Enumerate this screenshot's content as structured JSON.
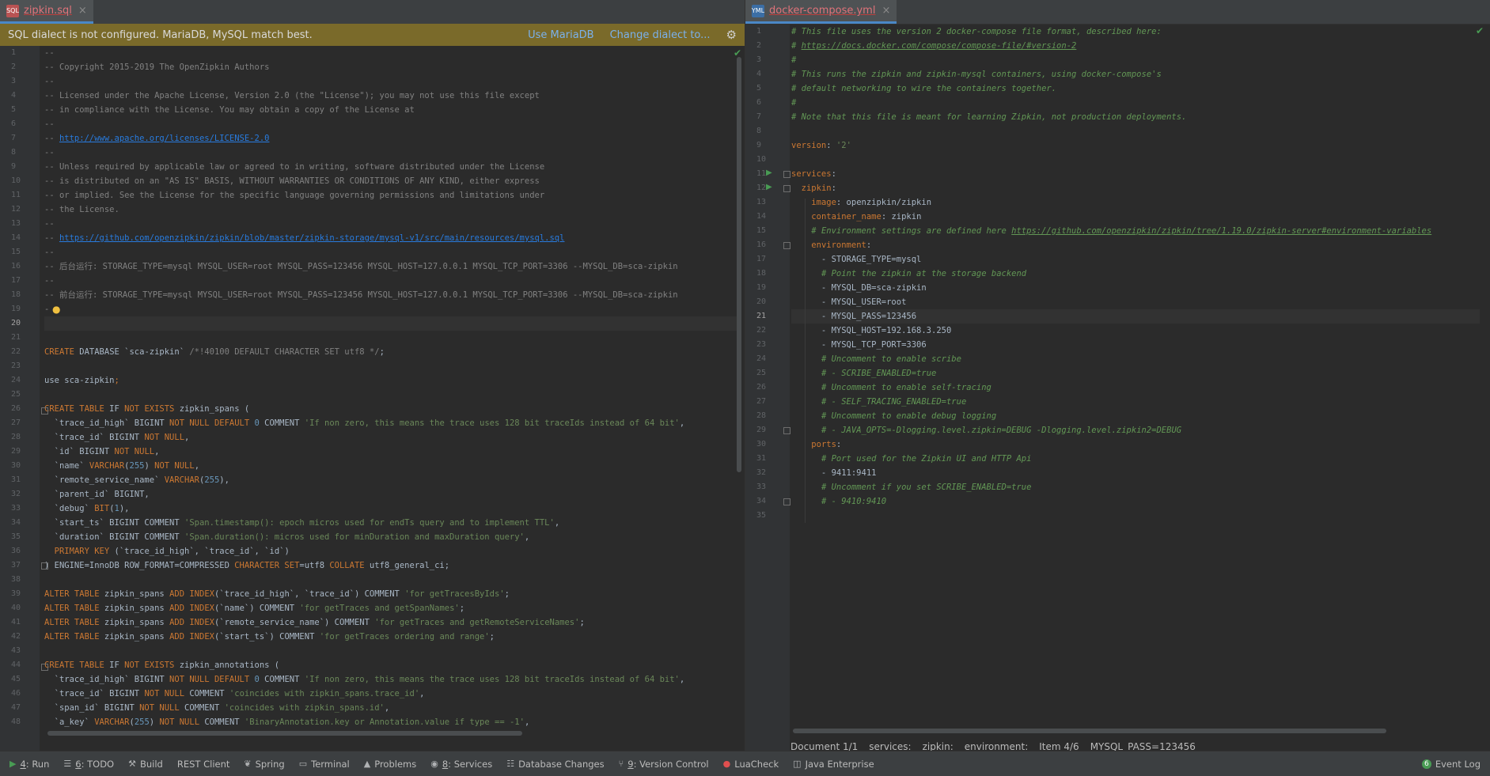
{
  "left": {
    "tab": {
      "title": "zipkin.sql",
      "icon": "sql-file-icon"
    },
    "banner": {
      "text": "SQL dialect is not configured. MariaDB, MySQL match best.",
      "link1": "Use MariaDB",
      "link2": "Change dialect to..."
    },
    "lines": [
      [
        [
          "cm",
          "--"
        ]
      ],
      [
        [
          "cm",
          "-- Copyright 2015-2019 The OpenZipkin Authors"
        ]
      ],
      [
        [
          "cm",
          "--"
        ]
      ],
      [
        [
          "cm",
          "-- Licensed under the Apache License, Version 2.0 (the \"License\"); you may not use this file except"
        ]
      ],
      [
        [
          "cm",
          "-- in compliance with the License. You may obtain a copy of the License at"
        ]
      ],
      [
        [
          "cm",
          "--"
        ]
      ],
      [
        [
          "cm",
          "-- "
        ],
        [
          "url",
          "http://www.apache.org/licenses/LICENSE-2.0"
        ]
      ],
      [
        [
          "cm",
          "--"
        ]
      ],
      [
        [
          "cm",
          "-- Unless required by applicable law or agreed to in writing, software distributed under the License"
        ]
      ],
      [
        [
          "cm",
          "-- is distributed on an \"AS IS\" BASIS, WITHOUT WARRANTIES OR CONDITIONS OF ANY KIND, either express"
        ]
      ],
      [
        [
          "cm",
          "-- or implied. See the License for the specific language governing permissions and limitations under"
        ]
      ],
      [
        [
          "cm",
          "-- the License."
        ]
      ],
      [
        [
          "cm",
          "--"
        ]
      ],
      [
        [
          "cm",
          "-- "
        ],
        [
          "url",
          "https://github.com/openzipkin/zipkin/blob/master/zipkin-storage/mysql-v1/src/main/resources/mysql.sql"
        ]
      ],
      [
        [
          "cm",
          "--"
        ]
      ],
      [
        [
          "cm",
          "-- 后台运行: STORAGE_TYPE=mysql MYSQL_USER=root MYSQL_PASS=123456 MYSQL_HOST=127.0.0.1 MYSQL_TCP_PORT=3306 --MYSQL_DB=sca-zipkin"
        ]
      ],
      [
        [
          "cm",
          "--"
        ]
      ],
      [
        [
          "cm",
          "-- 前台运行: STORAGE_TYPE=mysql MYSQL_USER=root MYSQL_PASS=123456 MYSQL_HOST=127.0.0.1 MYSQL_TCP_PORT=3306 --MYSQL_DB=sca-zipkin"
        ]
      ],
      [
        [
          "cm",
          "-"
        ]
      ],
      [],
      [],
      [
        [
          "kw",
          "CREATE"
        ],
        [
          "pl",
          " DATABASE `sca-zipkin` "
        ],
        [
          "cm",
          "/*!40100 DEFAULT CHARACTER SET utf8 */"
        ],
        [
          "pl",
          ";"
        ]
      ],
      [],
      [
        [
          "pl",
          "use sca-zipkin"
        ],
        [
          "kw",
          ";"
        ]
      ],
      [],
      [
        [
          "kw",
          "CREATE TABLE"
        ],
        [
          "pl",
          " IF "
        ],
        [
          "kw",
          "NOT EXISTS"
        ],
        [
          "pl",
          " zipkin_spans ("
        ]
      ],
      [
        [
          "pl",
          "  `trace_id_high` BIGINT "
        ],
        [
          "kw",
          "NOT NULL DEFAULT"
        ],
        [
          "pl",
          " "
        ],
        [
          "num",
          "0"
        ],
        [
          "pl",
          " COMMENT "
        ],
        [
          "str",
          "'If non zero, this means the trace uses 128 bit traceIds instead of 64 bit'"
        ],
        [
          "pl",
          ","
        ]
      ],
      [
        [
          "pl",
          "  `trace_id` BIGINT "
        ],
        [
          "kw",
          "NOT NULL"
        ],
        [
          "pl",
          ","
        ]
      ],
      [
        [
          "pl",
          "  `id` BIGINT "
        ],
        [
          "kw",
          "NOT NULL"
        ],
        [
          "pl",
          ","
        ]
      ],
      [
        [
          "pl",
          "  `name` "
        ],
        [
          "kw",
          "VARCHAR"
        ],
        [
          "pl",
          "("
        ],
        [
          "num",
          "255"
        ],
        [
          "pl",
          ") "
        ],
        [
          "kw",
          "NOT NULL"
        ],
        [
          "pl",
          ","
        ]
      ],
      [
        [
          "pl",
          "  `remote_service_name` "
        ],
        [
          "kw",
          "VARCHAR"
        ],
        [
          "pl",
          "("
        ],
        [
          "num",
          "255"
        ],
        [
          "pl",
          "),"
        ]
      ],
      [
        [
          "pl",
          "  `parent_id` BIGINT,"
        ]
      ],
      [
        [
          "pl",
          "  `debug` "
        ],
        [
          "kw",
          "BIT"
        ],
        [
          "pl",
          "("
        ],
        [
          "num",
          "1"
        ],
        [
          "pl",
          "),"
        ]
      ],
      [
        [
          "pl",
          "  `start_ts` BIGINT COMMENT "
        ],
        [
          "str",
          "'Span.timestamp(): epoch micros used for endTs query and to implement TTL'"
        ],
        [
          "pl",
          ","
        ]
      ],
      [
        [
          "pl",
          "  `duration` BIGINT COMMENT "
        ],
        [
          "str",
          "'Span.duration(): micros used for minDuration and maxDuration query'"
        ],
        [
          "pl",
          ","
        ]
      ],
      [
        [
          "pl",
          "  "
        ],
        [
          "kw",
          "PRIMARY KEY"
        ],
        [
          "pl",
          " (`trace_id_high`, `trace_id`, `id`)"
        ]
      ],
      [
        [
          "pl",
          ") ENGINE=InnoDB ROW_FORMAT=COMPRESSED "
        ],
        [
          "kw",
          "CHARACTER SET"
        ],
        [
          "pl",
          "=utf8 "
        ],
        [
          "kw",
          "COLLATE"
        ],
        [
          "pl",
          " utf8_general_ci;"
        ]
      ],
      [],
      [
        [
          "kw",
          "ALTER TABLE"
        ],
        [
          "pl",
          " zipkin_spans "
        ],
        [
          "kw",
          "ADD INDEX"
        ],
        [
          "pl",
          "(`trace_id_high`, `trace_id`) COMMENT "
        ],
        [
          "str",
          "'for getTracesByIds'"
        ],
        [
          "pl",
          ";"
        ]
      ],
      [
        [
          "kw",
          "ALTER TABLE"
        ],
        [
          "pl",
          " zipkin_spans "
        ],
        [
          "kw",
          "ADD INDEX"
        ],
        [
          "pl",
          "(`name`) COMMENT "
        ],
        [
          "str",
          "'for getTraces and getSpanNames'"
        ],
        [
          "pl",
          ";"
        ]
      ],
      [
        [
          "kw",
          "ALTER TABLE"
        ],
        [
          "pl",
          " zipkin_spans "
        ],
        [
          "kw",
          "ADD INDEX"
        ],
        [
          "pl",
          "(`remote_service_name`) COMMENT "
        ],
        [
          "str",
          "'for getTraces and getRemoteServiceNames'"
        ],
        [
          "pl",
          ";"
        ]
      ],
      [
        [
          "kw",
          "ALTER TABLE"
        ],
        [
          "pl",
          " zipkin_spans "
        ],
        [
          "kw",
          "ADD INDEX"
        ],
        [
          "pl",
          "(`start_ts`) COMMENT "
        ],
        [
          "str",
          "'for getTraces ordering and range'"
        ],
        [
          "pl",
          ";"
        ]
      ],
      [],
      [
        [
          "kw",
          "CREATE TABLE"
        ],
        [
          "pl",
          " IF "
        ],
        [
          "kw",
          "NOT EXISTS"
        ],
        [
          "pl",
          " zipkin_annotations ("
        ]
      ],
      [
        [
          "pl",
          "  `trace_id_high` BIGINT "
        ],
        [
          "kw",
          "NOT NULL DEFAULT"
        ],
        [
          "pl",
          " "
        ],
        [
          "num",
          "0"
        ],
        [
          "pl",
          " COMMENT "
        ],
        [
          "str",
          "'If non zero, this means the trace uses 128 bit traceIds instead of 64 bit'"
        ],
        [
          "pl",
          ","
        ]
      ],
      [
        [
          "pl",
          "  `trace_id` BIGINT "
        ],
        [
          "kw",
          "NOT NULL"
        ],
        [
          "pl",
          " COMMENT "
        ],
        [
          "str",
          "'coincides with zipkin_spans.trace_id'"
        ],
        [
          "pl",
          ","
        ]
      ],
      [
        [
          "pl",
          "  `span_id` BIGINT "
        ],
        [
          "kw",
          "NOT NULL"
        ],
        [
          "pl",
          " COMMENT "
        ],
        [
          "str",
          "'coincides with zipkin_spans.id'"
        ],
        [
          "pl",
          ","
        ]
      ],
      [
        [
          "pl",
          "  `a_key` "
        ],
        [
          "kw",
          "VARCHAR"
        ],
        [
          "pl",
          "("
        ],
        [
          "num",
          "255"
        ],
        [
          "pl",
          ") "
        ],
        [
          "kw",
          "NOT NULL"
        ],
        [
          "pl",
          " COMMENT "
        ],
        [
          "str",
          "'BinaryAnnotation.key or Annotation.value if type == -1'"
        ],
        [
          "pl",
          ","
        ]
      ]
    ],
    "current_line": 20
  },
  "right": {
    "tab": {
      "title": "docker-compose.yml",
      "icon": "yaml-file-icon"
    },
    "lines": [
      [
        [
          "cmi",
          "# This file uses the version 2 docker-compose file format, described here:"
        ]
      ],
      [
        [
          "cmi",
          "# "
        ],
        [
          "urli",
          "https://docs.docker.com/compose/compose-file/#version-2"
        ]
      ],
      [
        [
          "cmi",
          "#"
        ]
      ],
      [
        [
          "cmi",
          "# This runs the zipkin and zipkin-mysql containers, using docker-compose's"
        ]
      ],
      [
        [
          "cmi",
          "# default networking to wire the containers together."
        ]
      ],
      [
        [
          "cmi",
          "#"
        ]
      ],
      [
        [
          "cmi",
          "# Note that this file is meant for learning Zipkin, not production deployments."
        ]
      ],
      [],
      [
        [
          "key",
          "version"
        ],
        [
          "pl",
          ": "
        ],
        [
          "str",
          "'2'"
        ]
      ],
      [],
      [
        [
          "key",
          "services"
        ],
        [
          "pl",
          ":"
        ]
      ],
      [
        [
          "pl",
          "  "
        ],
        [
          "key",
          "zipkin"
        ],
        [
          "pl",
          ":"
        ]
      ],
      [
        [
          "pl",
          "    "
        ],
        [
          "key",
          "image"
        ],
        [
          "pl",
          ": openzipkin/zipkin"
        ]
      ],
      [
        [
          "pl",
          "    "
        ],
        [
          "key",
          "container_name"
        ],
        [
          "pl",
          ": zipkin"
        ]
      ],
      [
        [
          "pl",
          "    "
        ],
        [
          "cmi",
          "# Environment settings are defined here "
        ],
        [
          "urli",
          "https://github.com/openzipkin/zipkin/tree/1.19.0/zipkin-server#environment-variables"
        ]
      ],
      [
        [
          "pl",
          "    "
        ],
        [
          "key",
          "environment"
        ],
        [
          "pl",
          ":"
        ]
      ],
      [
        [
          "pl",
          "      - STORAGE_TYPE=mysql"
        ]
      ],
      [
        [
          "pl",
          "      "
        ],
        [
          "cmi",
          "# Point the zipkin at the storage backend"
        ]
      ],
      [
        [
          "pl",
          "      - MYSQL_DB=sca-zipkin"
        ]
      ],
      [
        [
          "pl",
          "      - MYSQL_USER=root"
        ]
      ],
      [
        [
          "pl",
          "      - MYSQL_PASS=123456"
        ]
      ],
      [
        [
          "pl",
          "      - MYSQL_HOST=192.168.3.250"
        ]
      ],
      [
        [
          "pl",
          "      - MYSQL_TCP_PORT=3306"
        ]
      ],
      [
        [
          "pl",
          "      "
        ],
        [
          "cmi",
          "# Uncomment to enable scribe"
        ]
      ],
      [
        [
          "pl",
          "      "
        ],
        [
          "cmi",
          "# - SCRIBE_ENABLED=true"
        ]
      ],
      [
        [
          "pl",
          "      "
        ],
        [
          "cmi",
          "# Uncomment to enable self-tracing"
        ]
      ],
      [
        [
          "pl",
          "      "
        ],
        [
          "cmi",
          "# - SELF_TRACING_ENABLED=true"
        ]
      ],
      [
        [
          "pl",
          "      "
        ],
        [
          "cmi",
          "# Uncomment to enable debug logging"
        ]
      ],
      [
        [
          "pl",
          "      "
        ],
        [
          "cmi",
          "# - JAVA_OPTS=-Dlogging.level.zipkin=DEBUG -Dlogging.level.zipkin2=DEBUG"
        ]
      ],
      [
        [
          "pl",
          "    "
        ],
        [
          "key",
          "ports"
        ],
        [
          "pl",
          ":"
        ]
      ],
      [
        [
          "pl",
          "      "
        ],
        [
          "cmi",
          "# Port used for the Zipkin UI and HTTP Api"
        ]
      ],
      [
        [
          "pl",
          "      - 9411:9411"
        ]
      ],
      [
        [
          "pl",
          "      "
        ],
        [
          "cmi",
          "# Uncomment if you set SCRIBE_ENABLED=true"
        ]
      ],
      [
        [
          "pl",
          "      "
        ],
        [
          "cmi",
          "# - 9410:9410"
        ]
      ],
      []
    ],
    "current_line": 21,
    "breadcrumbs": [
      "Document 1/1",
      "services:",
      "zipkin:",
      "environment:",
      "Item 4/6",
      "MYSQL_PASS=123456"
    ]
  },
  "statusbar": {
    "tools": [
      {
        "icon": "run-icon",
        "num": "4",
        "label": ": Run"
      },
      {
        "icon": "todo-icon",
        "num": "6",
        "label": ": TODO"
      },
      {
        "icon": "build-icon",
        "num": "",
        "label": "Build"
      },
      {
        "icon": "",
        "num": "",
        "label": "REST Client"
      },
      {
        "icon": "spring-icon",
        "num": "",
        "label": "Spring"
      },
      {
        "icon": "terminal-icon",
        "num": "",
        "label": "Terminal"
      },
      {
        "icon": "problems-icon",
        "num": "",
        "label": "Problems"
      },
      {
        "icon": "services-icon",
        "num": "8",
        "label": ": Services"
      },
      {
        "icon": "database-icon",
        "num": "",
        "label": "Database Changes"
      },
      {
        "icon": "git-icon",
        "num": "9",
        "label": ": Version Control"
      },
      {
        "icon": "luacheck-icon",
        "num": "",
        "label": "LuaCheck"
      },
      {
        "icon": "java-enterprise-icon",
        "num": "",
        "label": "Java Enterprise"
      }
    ],
    "event_log": {
      "count": "6",
      "label": "Event Log"
    }
  }
}
